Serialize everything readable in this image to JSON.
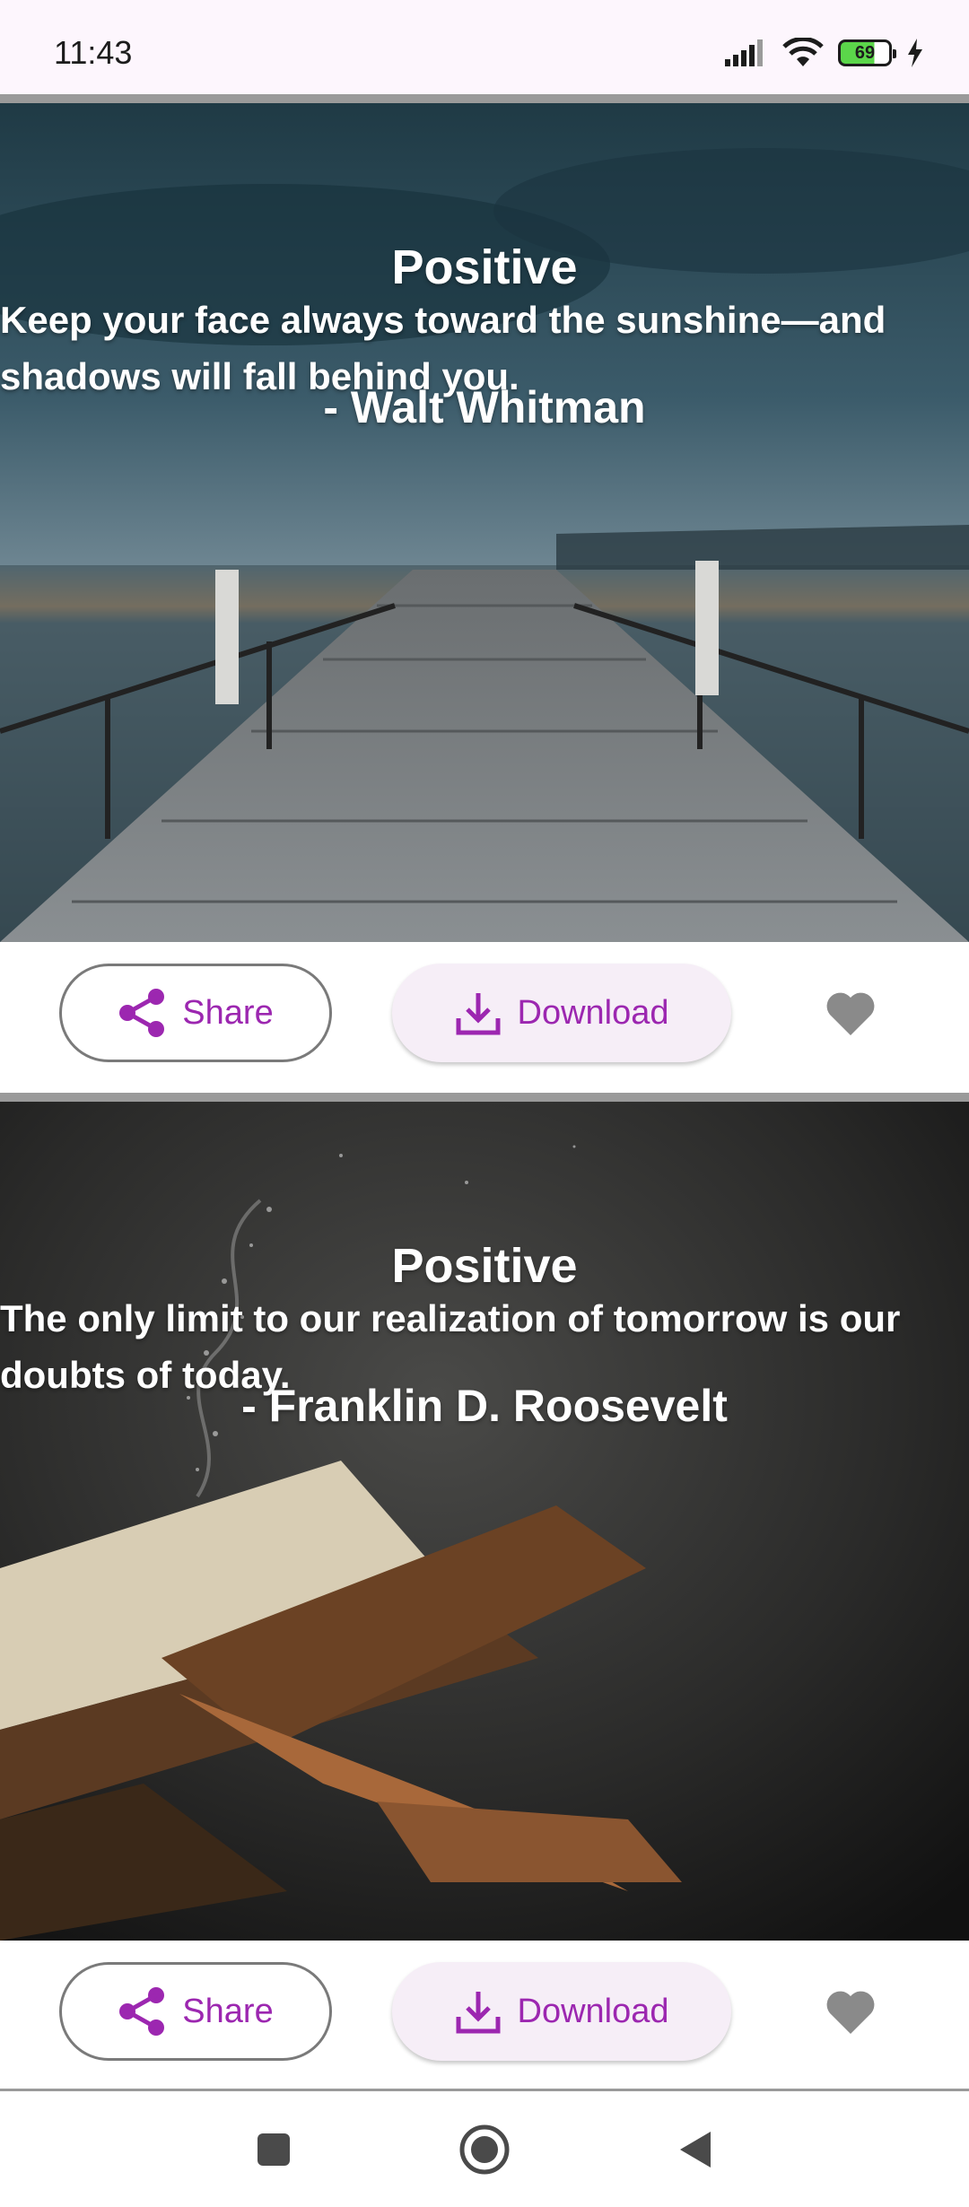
{
  "status_bar": {
    "time": "11:43",
    "battery_level": "69",
    "icons": [
      "signal-icon",
      "wifi-icon",
      "battery-icon",
      "charging-icon"
    ]
  },
  "cards": [
    {
      "category": "Positive",
      "quote": "Keep your face always toward the sunshine—and shadows will fall behind you.",
      "author": "- Walt Whitman",
      "background": "pier-at-dusk",
      "share_label": "Share",
      "download_label": "Download"
    },
    {
      "category": "Positive",
      "quote": "The only limit to our realization of tomorrow is our doubts of today.",
      "author": "- Franklin D. Roosevelt",
      "background": "open-book-on-stand",
      "share_label": "Share",
      "download_label": "Download"
    }
  ],
  "nav": {
    "icons": [
      "recents-icon",
      "home-icon",
      "back-icon"
    ]
  },
  "colors": {
    "accent": "#9c27b0",
    "status_bar_bg": "#fdf6fd",
    "divider": "#9a9a9a",
    "favorite_icon": "#8a8a8a"
  }
}
